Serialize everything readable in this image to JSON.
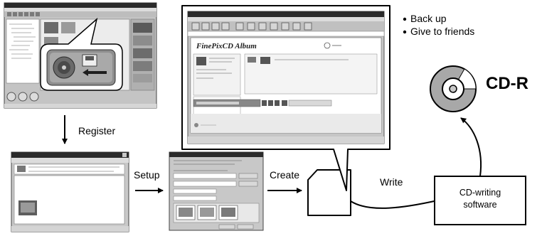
{
  "bullets": [
    "Back up",
    "Give to friends"
  ],
  "labels": {
    "register": "Register",
    "setup": "Setup",
    "create": "Create",
    "write": "Write",
    "cdr": "CD-R",
    "software_line1": "CD-writing",
    "software_line2": "software"
  },
  "screens": {
    "large_app_title": "FinePixCD Album"
  },
  "colors": {
    "window_gray": "#c6c6c6",
    "titlebar": "#2a2a2a",
    "disc_gray": "#a8a8a8"
  }
}
